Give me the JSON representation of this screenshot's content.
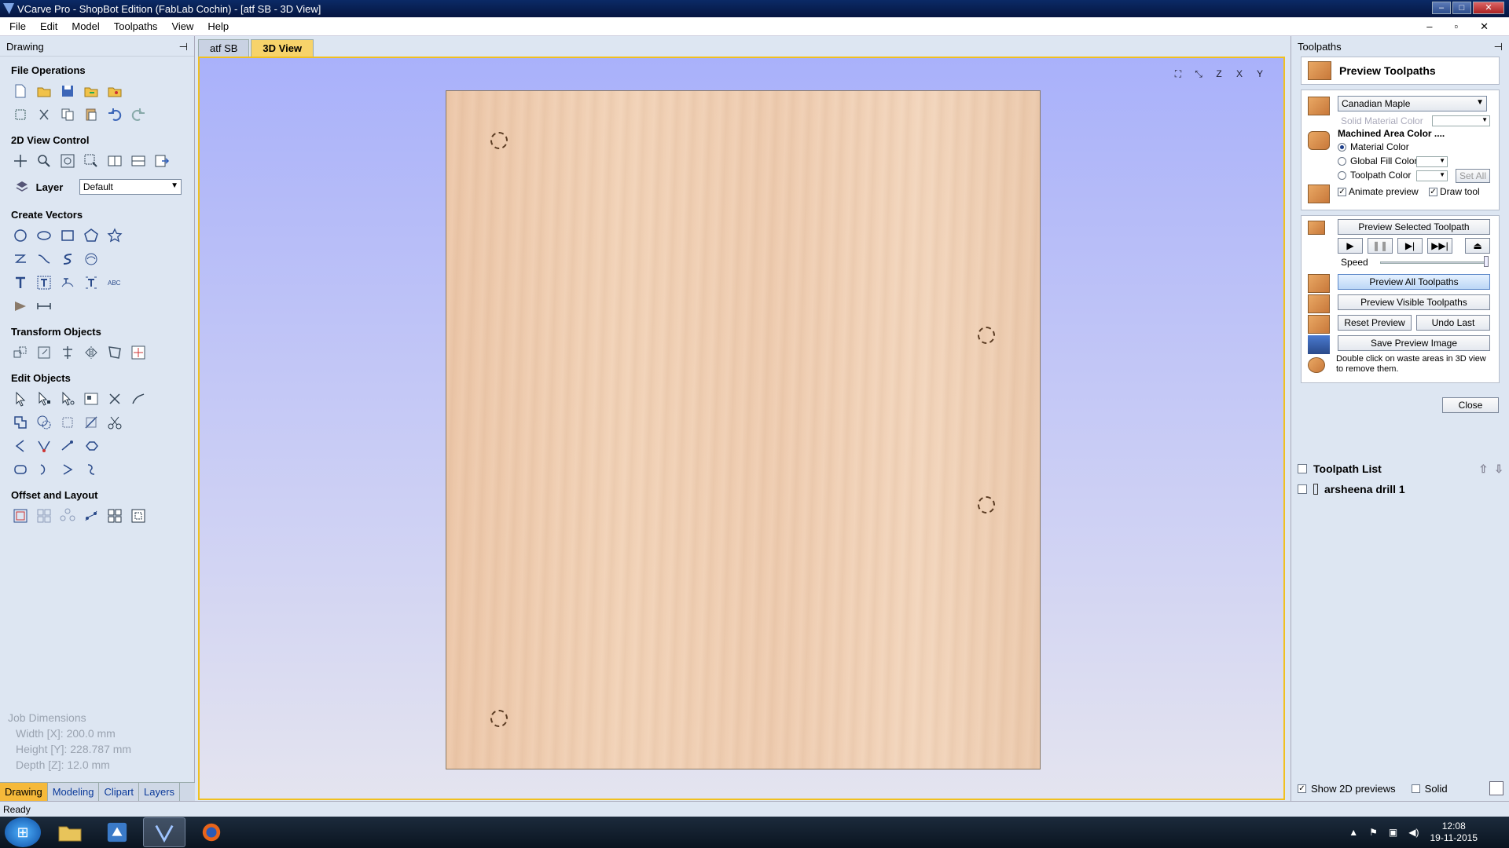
{
  "window": {
    "title": "VCarve Pro - ShopBot Edition (FabLab Cochin) - [atf SB - 3D View]",
    "controls": [
      "–",
      "□",
      "✕"
    ]
  },
  "menu": [
    "File",
    "Edit",
    "Model",
    "Toolpaths",
    "View",
    "Help"
  ],
  "mdi_controls": [
    "–",
    "▫",
    "✕"
  ],
  "left_panel": {
    "title": "Drawing",
    "pin": "⊣",
    "sections": {
      "file_ops": "File Operations",
      "view_control": "2D View Control",
      "create_vectors": "Create Vectors",
      "transform": "Transform Objects",
      "edit": "Edit Objects",
      "offset": "Offset and Layout"
    },
    "layer": {
      "label": "Layer",
      "value": "Default"
    },
    "job": {
      "title": "Job Dimensions",
      "width": "Width  [X]: 200.0 mm",
      "height": "Height [Y]: 228.787 mm",
      "depth": "Depth  [Z]: 12.0 mm"
    },
    "tabs": [
      "Drawing",
      "Modeling",
      "Clipart",
      "Layers"
    ]
  },
  "view": {
    "tabs": [
      "atf SB",
      "3D View"
    ],
    "icons": [
      "fit-view-icon",
      "iso-view-icon",
      "z-view-icon",
      "x-view-icon",
      "y-view-icon"
    ],
    "icon_glyphs": [
      "⛶",
      "⤡",
      "Z",
      "X",
      "Y"
    ]
  },
  "right_panel": {
    "title": "Toolpaths",
    "preview_title": "Preview Toolpaths",
    "material": "Canadian Maple",
    "solid_material_color": "Solid Material Color",
    "machined_area": "Machined Area Color ....",
    "material_color": "Material Color",
    "global_fill_color": "Global Fill Color",
    "toolpath_color": "Toolpath Color",
    "set_all": "Set All",
    "animate_preview": "Animate preview",
    "draw_tool": "Draw tool",
    "preview_selected": "Preview Selected Toolpath",
    "speed": "Speed",
    "preview_all": "Preview All Toolpaths",
    "preview_visible": "Preview Visible Toolpaths",
    "reset_preview": "Reset Preview",
    "undo_last": "Undo Last",
    "save_preview": "Save Preview Image",
    "hint": "Double click on waste areas in 3D view to remove them.",
    "close": "Close",
    "toolpath_list_title": "Toolpath List",
    "toolpaths": [
      "arsheena drill 1"
    ],
    "show_2d": "Show 2D previews",
    "solid": "Solid",
    "playback": [
      "▶",
      "❚❚",
      "▶|",
      "▶▶|",
      "⏏"
    ]
  },
  "status": "Ready",
  "taskbar": {
    "time": "12:08",
    "date": "19-11-2015"
  }
}
